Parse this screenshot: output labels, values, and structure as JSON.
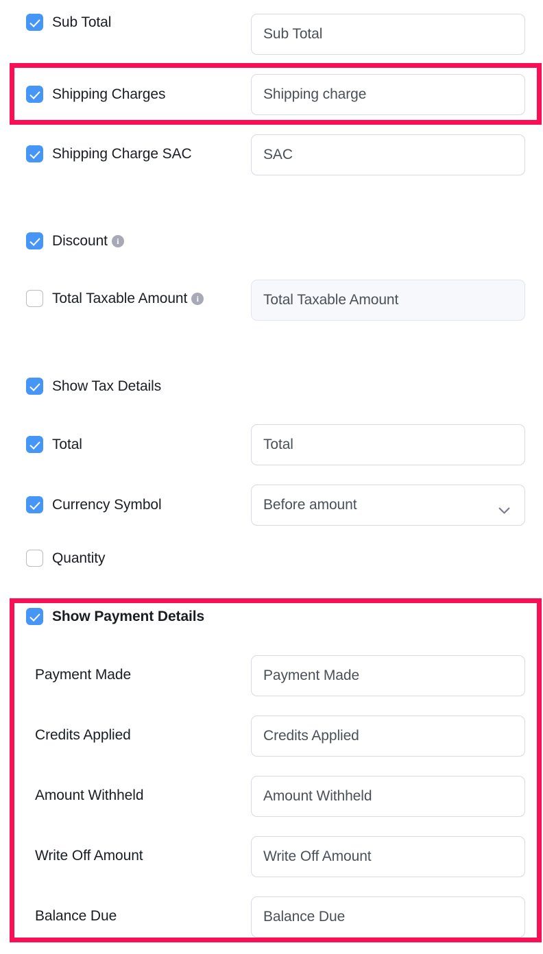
{
  "colors": {
    "highlight": "#FA0F54",
    "checkbox_on": "#4596F7",
    "checkbox_off_border": "#B9BCC4",
    "label_text": "#1A1D21",
    "placeholder_text": "#4A5058",
    "field_border": "#D8DAE3",
    "field_disabled_bg": "#F7F8FB",
    "info_icon_bg": "#A7A9B7"
  },
  "icons": {
    "check": "check-icon",
    "info": "info-icon",
    "chevron_down": "chevron-down-icon"
  },
  "rows": [
    {
      "id": "sub-total",
      "label": "Sub Total",
      "checkbox": true,
      "checked": true,
      "bold": false,
      "info": false,
      "field": {
        "type": "text",
        "placeholder": "Sub Total",
        "value": "",
        "disabled": false
      }
    },
    {
      "id": "shipping-charges",
      "label": "Shipping Charges",
      "checkbox": true,
      "checked": true,
      "bold": false,
      "info": false,
      "field": {
        "type": "text",
        "placeholder": "Shipping charge",
        "value": "",
        "disabled": false
      }
    },
    {
      "id": "shipping-charge-sac",
      "label": "Shipping Charge SAC",
      "checkbox": true,
      "checked": true,
      "bold": false,
      "info": false,
      "field": {
        "type": "text",
        "placeholder": "SAC",
        "value": "",
        "disabled": false
      }
    },
    {
      "id": "discount",
      "label": "Discount",
      "checkbox": true,
      "checked": true,
      "bold": false,
      "info": true,
      "field": null
    },
    {
      "id": "total-taxable-amount",
      "label": "Total Taxable Amount",
      "checkbox": true,
      "checked": false,
      "bold": false,
      "info": true,
      "field": {
        "type": "text",
        "placeholder": "Total Taxable Amount",
        "value": "",
        "disabled": true
      }
    },
    {
      "id": "show-tax-details",
      "label": "Show Tax Details",
      "checkbox": true,
      "checked": true,
      "bold": false,
      "info": false,
      "field": null
    },
    {
      "id": "total",
      "label": "Total",
      "checkbox": true,
      "checked": true,
      "bold": false,
      "info": false,
      "field": {
        "type": "text",
        "placeholder": "Total",
        "value": "",
        "disabled": false
      }
    },
    {
      "id": "currency-symbol",
      "label": "Currency Symbol",
      "checkbox": true,
      "checked": true,
      "bold": false,
      "info": false,
      "field": {
        "type": "select",
        "value": "Before amount",
        "placeholder": "",
        "disabled": false
      }
    },
    {
      "id": "quantity",
      "label": "Quantity",
      "checkbox": true,
      "checked": false,
      "bold": false,
      "info": false,
      "field": null
    },
    {
      "id": "show-payment-details",
      "label": "Show Payment Details",
      "checkbox": true,
      "checked": true,
      "bold": true,
      "info": false,
      "field": null
    },
    {
      "id": "payment-made",
      "label": "Payment Made",
      "checkbox": false,
      "checked": false,
      "bold": false,
      "info": false,
      "field": {
        "type": "text",
        "placeholder": "Payment Made",
        "value": "",
        "disabled": false
      }
    },
    {
      "id": "credits-applied",
      "label": "Credits Applied",
      "checkbox": false,
      "checked": false,
      "bold": false,
      "info": false,
      "field": {
        "type": "text",
        "placeholder": "Credits Applied",
        "value": "",
        "disabled": false
      }
    },
    {
      "id": "amount-withheld",
      "label": "Amount Withheld",
      "checkbox": false,
      "checked": false,
      "bold": false,
      "info": false,
      "field": {
        "type": "text",
        "placeholder": "Amount Withheld",
        "value": "",
        "disabled": false
      }
    },
    {
      "id": "write-off-amount",
      "label": "Write Off Amount",
      "checkbox": false,
      "checked": false,
      "bold": false,
      "info": false,
      "field": {
        "type": "text",
        "placeholder": "Write Off Amount",
        "value": "",
        "disabled": false
      }
    },
    {
      "id": "balance-due",
      "label": "Balance Due",
      "checkbox": false,
      "checked": false,
      "bold": false,
      "info": false,
      "field": {
        "type": "text",
        "placeholder": "Balance Due",
        "value": "",
        "disabled": false
      }
    }
  ],
  "highlights": [
    {
      "id": "highlight-shipping-charges",
      "rows": [
        "shipping-charges"
      ]
    },
    {
      "id": "highlight-payment-details",
      "rows": [
        "show-payment-details",
        "payment-made",
        "credits-applied",
        "amount-withheld",
        "write-off-amount",
        "balance-due"
      ]
    }
  ]
}
